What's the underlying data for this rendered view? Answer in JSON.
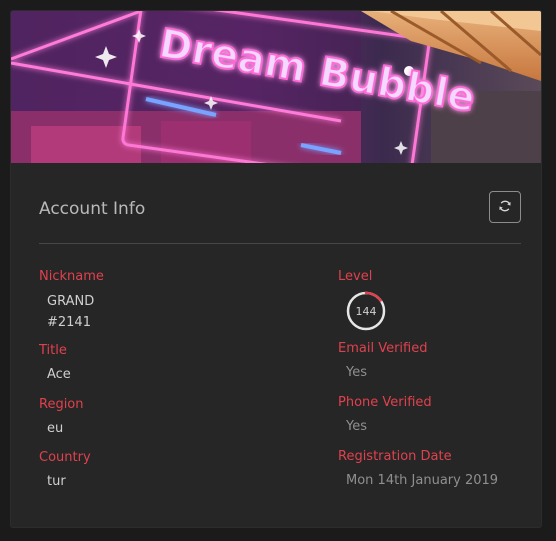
{
  "banner": {
    "sign_text": "Dream Bubble"
  },
  "card": {
    "title": "Account Info"
  },
  "colors": {
    "label": "#e0414e",
    "value": "#cfcfcf",
    "muted": "#8f8f8f",
    "level_ring": "#e0414e"
  },
  "fields": {
    "nickname": {
      "label": "Nickname",
      "value_line1": "GRAND",
      "value_line2": "#2141"
    },
    "title": {
      "label": "Title",
      "value": "Ace"
    },
    "region": {
      "label": "Region",
      "value": "eu"
    },
    "country": {
      "label": "Country",
      "value": "tur"
    },
    "level": {
      "label": "Level",
      "value": "144",
      "progress": 0.15
    },
    "email_verified": {
      "label": "Email Verified",
      "value": "Yes"
    },
    "phone_verified": {
      "label": "Phone Verified",
      "value": "Yes"
    },
    "registration_date": {
      "label": "Registration Date",
      "value": "Mon 14th January 2019"
    }
  },
  "icons": {
    "refresh": "refresh-icon"
  }
}
